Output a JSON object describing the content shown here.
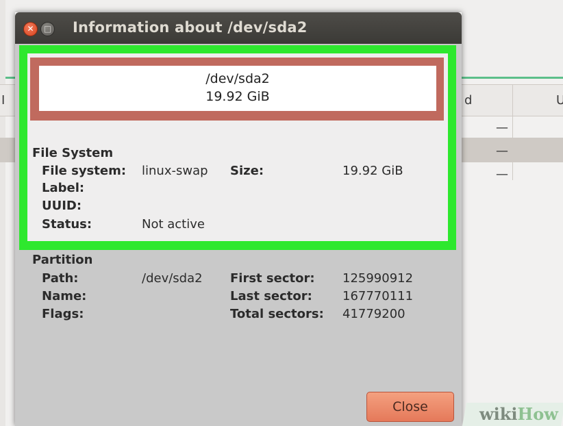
{
  "dialog": {
    "title": "Information about /dev/sda2",
    "close_glyph": "✕",
    "min_glyph": "□",
    "device": {
      "name": "/dev/sda2",
      "size": "19.92 GiB"
    },
    "file_system_section": {
      "title": "File System",
      "file_system_label": "File system:",
      "file_system_value": "linux-swap",
      "size_label": "Size:",
      "size_value": "19.92 GiB",
      "label_label": "Label:",
      "uuid_label": "UUID:",
      "status_label": "Status:",
      "status_value": "Not active"
    },
    "partition_section": {
      "title": "Partition",
      "path_label": "Path:",
      "path_value": "/dev/sda2",
      "name_label": "Name:",
      "flags_label": "Flags:",
      "first_sector_label": "First sector:",
      "first_sector_value": "125990912",
      "last_sector_label": "Last sector:",
      "last_sector_value": "167770111",
      "total_sectors_label": "Total sectors:",
      "total_sectors_value": "41779200"
    },
    "close_button_label": "Close"
  },
  "background": {
    "header_left": "I",
    "header_mid": "d",
    "header_right": "U",
    "dashes": [
      "—",
      "—",
      "—"
    ]
  },
  "watermark": {
    "part1": "wiki",
    "part2": "How"
  },
  "colors": {
    "highlight_green": "#2ee82e",
    "device_frame_red": "#c06a5e",
    "close_button": "#e5795a",
    "titlebar": "#3b3a36"
  }
}
